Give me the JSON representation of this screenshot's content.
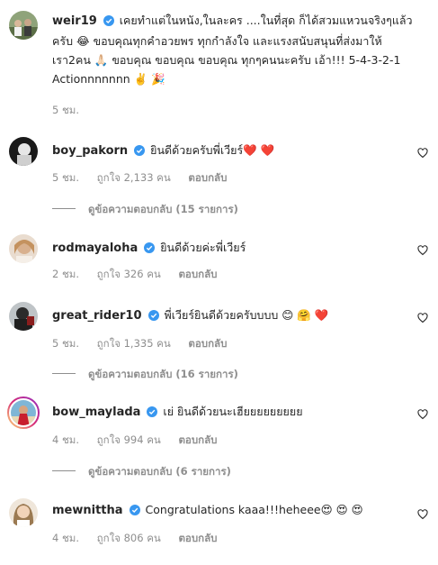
{
  "post": {
    "username": "weir19",
    "line1": "เคยทำแต่ในหนัง,ในละคร ....ในที่สุด ก็ได้สวมแหวนจริงๆแล้ว",
    "line2": "ครับ 😂 ขอบคุณทุกคำอวยพร ทุกกำลังใจ และแรงสนับสนุนที่ส่งมาให้",
    "line3": "เรา2คน 🙏🏻 ขอบคุณ ขอบคุณ ขอบคุณ ทุกๆคนนะครับ เอ้า!!! 5-4-3-2-1",
    "line4": "Actionnnnnnn ✌️ 🎉",
    "time": "5 ชม."
  },
  "comments": [
    {
      "username": "boy_pakorn",
      "text": "ยินดีด้วยครับพี่เวียร์❤️ ❤️",
      "time": "5 ชม.",
      "likes": "ถูกใจ 2,133 คน",
      "reply": "ตอบกลับ",
      "view_replies": "ดูข้อความตอบกลับ (15 รายการ)"
    },
    {
      "username": "rodmayaloha",
      "text": "ยินดีด้วยค่ะพี่เวียร์",
      "time": "2 ชม.",
      "likes": "ถูกใจ 326 คน",
      "reply": "ตอบกลับ"
    },
    {
      "username": "great_rider10",
      "text": "พี่เวียร์ยินดีด้วยครับบบบ 😊 🤗 ❤️",
      "time": "5 ชม.",
      "likes": "ถูกใจ 1,335 คน",
      "reply": "ตอบกลับ",
      "view_replies": "ดูข้อความตอบกลับ (16 รายการ)"
    },
    {
      "username": "bow_maylada",
      "text": "เย่ ยินดีด้วยนะเฮียยยยยยยยย",
      "time": "4 ชม.",
      "likes": "ถูกใจ 994 คน",
      "reply": "ตอบกลับ",
      "view_replies": "ดูข้อความตอบกลับ (6 รายการ)"
    },
    {
      "username": "mewnittha",
      "text": "Congratulations kaaa!!!heheee😍 😍 😍",
      "time": "4 ชม.",
      "likes": "ถูกใจ 806 คน",
      "reply": "ตอบกลับ"
    }
  ],
  "colors": {
    "verified": "#3897f0",
    "muted": "#8e8e8e",
    "text": "#262626",
    "story_ring": "#d6249f"
  }
}
